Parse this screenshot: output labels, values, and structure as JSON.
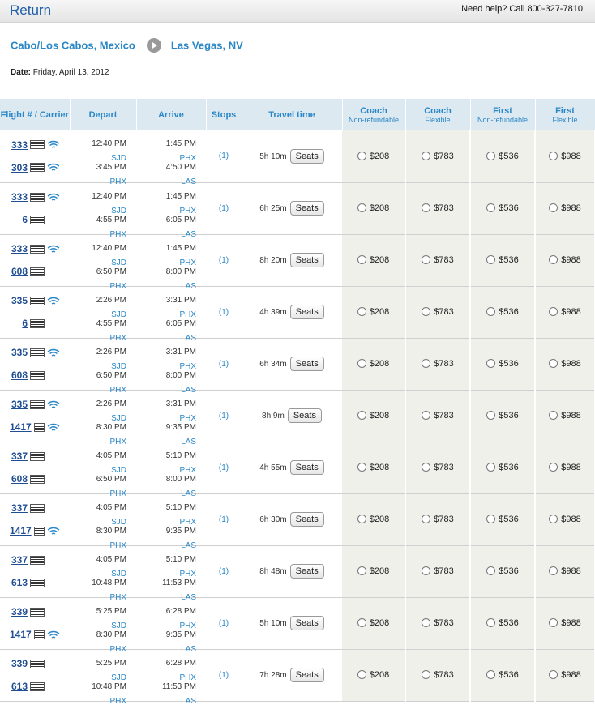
{
  "header": {
    "title": "Return",
    "help": "Need help? Call 800-327-7810."
  },
  "route": {
    "from": "Cabo/Los Cabos, Mexico",
    "to": "Las Vegas, NV"
  },
  "date": {
    "label": "Date:",
    "value": "Friday, April 13, 2012"
  },
  "columns": {
    "flight": "Flight # / Carrier",
    "depart": "Depart",
    "arrive": "Arrive",
    "stops": "Stops",
    "travel": "Travel time",
    "coach_nr": {
      "main": "Coach",
      "sub": "Non-refundable"
    },
    "coach_fx": {
      "main": "Coach",
      "sub": "Flexible"
    },
    "first_nr": {
      "main": "First",
      "sub": "Non-refundable"
    },
    "first_fx": {
      "main": "First",
      "sub": "Flexible"
    }
  },
  "seats_label": "Seats",
  "rows": [
    {
      "f1": "333",
      "w1": true,
      "f2": "303",
      "w2": true,
      "d1": "12:40 PM",
      "c1": "SJD",
      "d2": "3:45 PM",
      "c2": "PHX",
      "a1": "1:45 PM",
      "ac1": "PHX",
      "a2": "4:50 PM",
      "ac2": "LAS",
      "stops": "(1)",
      "time": "5h 10m",
      "p1": "$208",
      "p2": "$783",
      "p3": "$536",
      "p4": "$988"
    },
    {
      "f1": "333",
      "w1": true,
      "f2": "6",
      "w2": false,
      "d1": "12:40 PM",
      "c1": "SJD",
      "d2": "4:55 PM",
      "c2": "PHX",
      "a1": "1:45 PM",
      "ac1": "PHX",
      "a2": "6:05 PM",
      "ac2": "LAS",
      "stops": "(1)",
      "time": "6h 25m",
      "p1": "$208",
      "p2": "$783",
      "p3": "$536",
      "p4": "$988"
    },
    {
      "f1": "333",
      "w1": true,
      "f2": "608",
      "w2": false,
      "d1": "12:40 PM",
      "c1": "SJD",
      "d2": "6:50 PM",
      "c2": "PHX",
      "a1": "1:45 PM",
      "ac1": "PHX",
      "a2": "8:00 PM",
      "ac2": "LAS",
      "stops": "(1)",
      "time": "8h 20m",
      "p1": "$208",
      "p2": "$783",
      "p3": "$536",
      "p4": "$988"
    },
    {
      "f1": "335",
      "w1": true,
      "f2": "6",
      "w2": false,
      "d1": "2:26 PM",
      "c1": "SJD",
      "d2": "4:55 PM",
      "c2": "PHX",
      "a1": "3:31 PM",
      "ac1": "PHX",
      "a2": "6:05 PM",
      "ac2": "LAS",
      "stops": "(1)",
      "time": "4h 39m",
      "p1": "$208",
      "p2": "$783",
      "p3": "$536",
      "p4": "$988"
    },
    {
      "f1": "335",
      "w1": true,
      "f2": "608",
      "w2": false,
      "d1": "2:26 PM",
      "c1": "SJD",
      "d2": "6:50 PM",
      "c2": "PHX",
      "a1": "3:31 PM",
      "ac1": "PHX",
      "a2": "8:00 PM",
      "ac2": "LAS",
      "stops": "(1)",
      "time": "6h 34m",
      "p1": "$208",
      "p2": "$783",
      "p3": "$536",
      "p4": "$988"
    },
    {
      "f1": "335",
      "w1": true,
      "f2": "1417",
      "w2": true,
      "d1": "2:26 PM",
      "c1": "SJD",
      "d2": "8:30 PM",
      "c2": "PHX",
      "a1": "3:31 PM",
      "ac1": "PHX",
      "a2": "9:35 PM",
      "ac2": "LAS",
      "stops": "(1)",
      "time": "8h 9m",
      "p1": "$208",
      "p2": "$783",
      "p3": "$536",
      "p4": "$988"
    },
    {
      "f1": "337",
      "w1": false,
      "f2": "608",
      "w2": false,
      "d1": "4:05 PM",
      "c1": "SJD",
      "d2": "6:50 PM",
      "c2": "PHX",
      "a1": "5:10 PM",
      "ac1": "PHX",
      "a2": "8:00 PM",
      "ac2": "LAS",
      "stops": "(1)",
      "time": "4h 55m",
      "p1": "$208",
      "p2": "$783",
      "p3": "$536",
      "p4": "$988"
    },
    {
      "f1": "337",
      "w1": false,
      "f2": "1417",
      "w2": true,
      "d1": "4:05 PM",
      "c1": "SJD",
      "d2": "8:30 PM",
      "c2": "PHX",
      "a1": "5:10 PM",
      "ac1": "PHX",
      "a2": "9:35 PM",
      "ac2": "LAS",
      "stops": "(1)",
      "time": "6h 30m",
      "p1": "$208",
      "p2": "$783",
      "p3": "$536",
      "p4": "$988"
    },
    {
      "f1": "337",
      "w1": false,
      "f2": "613",
      "w2": false,
      "d1": "4:05 PM",
      "c1": "SJD",
      "d2": "10:48 PM",
      "c2": "PHX",
      "a1": "5:10 PM",
      "ac1": "PHX",
      "a2": "11:53 PM",
      "ac2": "LAS",
      "stops": "(1)",
      "time": "8h 48m",
      "p1": "$208",
      "p2": "$783",
      "p3": "$536",
      "p4": "$988"
    },
    {
      "f1": "339",
      "w1": false,
      "f2": "1417",
      "w2": true,
      "d1": "5:25 PM",
      "c1": "SJD",
      "d2": "8:30 PM",
      "c2": "PHX",
      "a1": "6:28 PM",
      "ac1": "PHX",
      "a2": "9:35 PM",
      "ac2": "LAS",
      "stops": "(1)",
      "time": "5h 10m",
      "p1": "$208",
      "p2": "$783",
      "p3": "$536",
      "p4": "$988"
    },
    {
      "f1": "339",
      "w1": false,
      "f2": "613",
      "w2": false,
      "d1": "5:25 PM",
      "c1": "SJD",
      "d2": "10:48 PM",
      "c2": "PHX",
      "a1": "6:28 PM",
      "ac1": "PHX",
      "a2": "11:53 PM",
      "ac2": "LAS",
      "stops": "(1)",
      "time": "7h 28m",
      "p1": "$208",
      "p2": "$783",
      "p3": "$536",
      "p4": "$988"
    }
  ]
}
